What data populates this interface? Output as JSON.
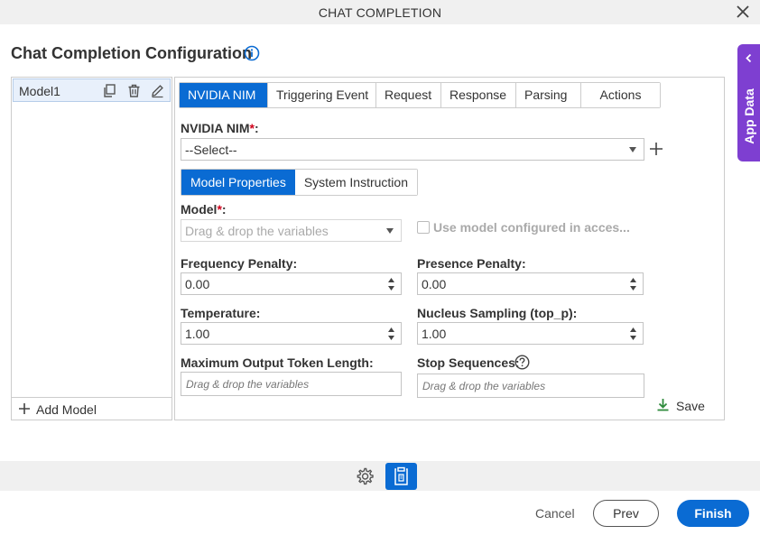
{
  "window": {
    "title": "CHAT COMPLETION",
    "close_icon": "close-icon"
  },
  "page": {
    "title": "Chat Completion Configuration",
    "info_icon": "info-icon"
  },
  "app_data_tab": {
    "label": "App Data",
    "icon": "chevron-left-icon"
  },
  "models": {
    "items": [
      {
        "name": "Model1"
      }
    ],
    "add_label": "Add Model",
    "item_icons": [
      "copy-icon",
      "delete-icon",
      "edit-icon"
    ]
  },
  "tabs": [
    {
      "label": "NVIDIA NIM",
      "active": true
    },
    {
      "label": "Triggering Event",
      "active": false
    },
    {
      "label": "Request",
      "active": false
    },
    {
      "label": "Response",
      "active": false
    },
    {
      "label": "Parsing",
      "active": false
    },
    {
      "label": "Actions",
      "active": false
    }
  ],
  "nim": {
    "label": "NVIDIA NIM",
    "required_mark": "*",
    "colon": ":",
    "selected": "--Select--"
  },
  "subtabs": [
    {
      "label": "Model Properties",
      "active": true
    },
    {
      "label": "System Instruction",
      "active": false
    }
  ],
  "model_field": {
    "label": "Model",
    "required_mark": "*",
    "colon": ":",
    "placeholder": "Drag & drop the variables"
  },
  "use_model_checkbox": {
    "label": "Use model configured in acces...",
    "checked": false
  },
  "frequency_penalty": {
    "label": "Frequency Penalty:",
    "value": "0.00"
  },
  "presence_penalty": {
    "label": "Presence Penalty:",
    "value": "0.00"
  },
  "temperature": {
    "label": "Temperature:",
    "value": "1.00"
  },
  "nucleus_sampling": {
    "label": "Nucleus Sampling (top_p):",
    "value": "1.00"
  },
  "max_output_tokens": {
    "label": "Maximum Output Token Length:",
    "placeholder": "Drag & drop the variables"
  },
  "stop_sequences": {
    "label": "Stop Sequences:",
    "placeholder": "Drag & drop the variables"
  },
  "save_label": "Save",
  "footer": {
    "cancel": "Cancel",
    "prev": "Prev",
    "finish": "Finish"
  },
  "colors": {
    "primary": "#0a6bd3",
    "app_data": "#7e3fd1",
    "required": "#d0021b",
    "save_icon": "#2e8b3c"
  }
}
